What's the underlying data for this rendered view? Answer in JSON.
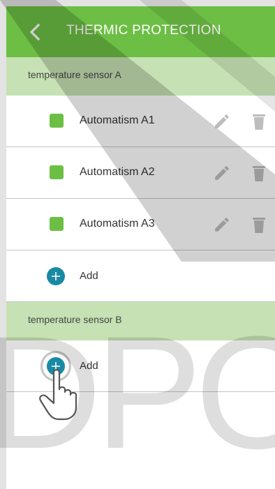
{
  "header": {
    "title": "THERMIC PROTECTION",
    "back_icon": "chevron-left-icon"
  },
  "colors": {
    "header_bg": "#6cbf44",
    "section_bg": "#c6e1b3",
    "status_green": "#6cbf44",
    "add_blue": "#1a8aa3"
  },
  "sections": [
    {
      "title": "temperature sensor A",
      "items": [
        {
          "label": "Automatism A1",
          "edit_icon": "pencil-icon",
          "delete_icon": "trash-icon"
        },
        {
          "label": "Automatism A2",
          "edit_icon": "pencil-icon",
          "delete_icon": "trash-icon"
        },
        {
          "label": "Automatism A3",
          "edit_icon": "pencil-icon",
          "delete_icon": "trash-icon"
        }
      ],
      "add_label": "Add"
    },
    {
      "title": "temperature sensor B",
      "items": [],
      "add_label": "Add"
    }
  ],
  "watermark": "DPOF"
}
